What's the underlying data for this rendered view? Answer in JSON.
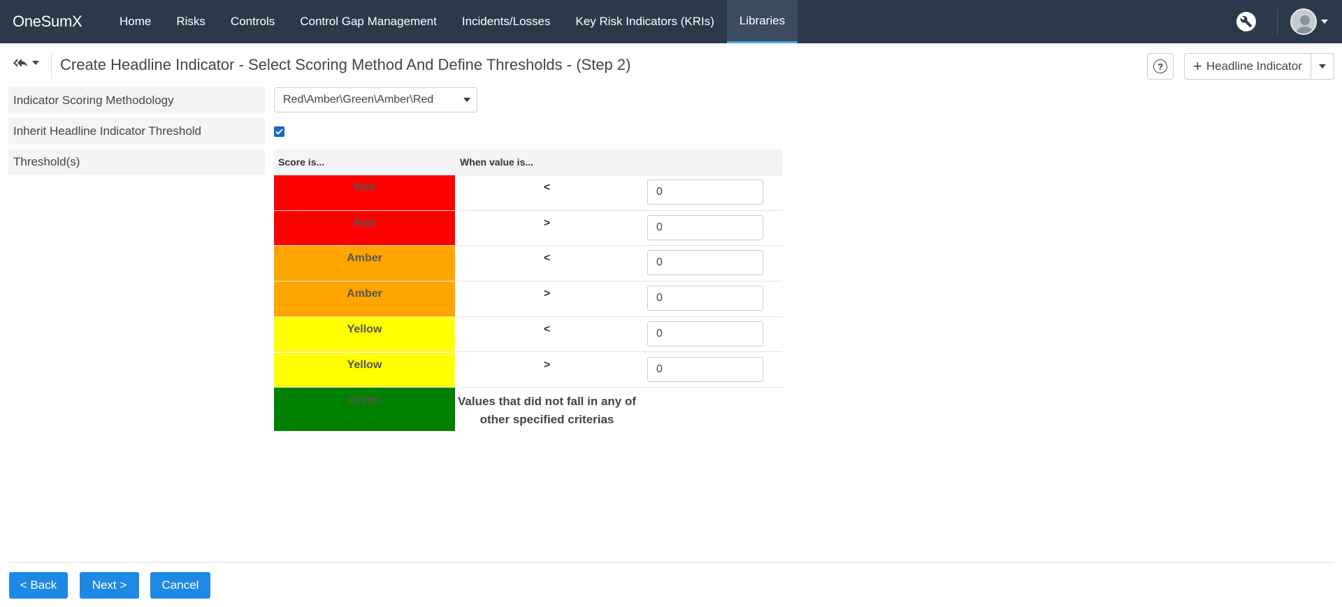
{
  "brand": "OneSumX",
  "nav": [
    "Home",
    "Risks",
    "Controls",
    "Control Gap Management",
    "Incidents/Losses",
    "Key Risk Indicators (KRIs)",
    "Libraries"
  ],
  "nav_active": "Libraries",
  "page": {
    "title": "Create Headline Indicator - Select Scoring Method And Define Thresholds - (Step 2)",
    "add_button": "Headline Indicator"
  },
  "form": {
    "scoring_label": "Indicator Scoring Methodology",
    "scoring_value": "Red\\Amber\\Green\\Amber\\Red",
    "inherit_label": "Inherit Headline Indicator Threshold",
    "inherit_checked": true,
    "thresholds_label": "Threshold(s)"
  },
  "table": {
    "col_score": "Score is...",
    "col_when": "When value is...",
    "rows": [
      {
        "score": "Red",
        "color": "#ff0000",
        "op": "<",
        "value": "0"
      },
      {
        "score": "Red",
        "color": "#ff0000",
        "op": ">",
        "value": "0"
      },
      {
        "score": "Amber",
        "color": "#ffa500",
        "op": "<",
        "value": "0"
      },
      {
        "score": "Amber",
        "color": "#ffa500",
        "op": ">",
        "value": "0"
      },
      {
        "score": "Yellow",
        "color": "#ffff00",
        "op": "<",
        "value": "0"
      },
      {
        "score": "Yellow",
        "color": "#ffff00",
        "op": ">",
        "value": "0"
      }
    ],
    "green": {
      "score": "Green",
      "color": "#008000",
      "text": "Values that did not fall in any of other specified criterias"
    }
  },
  "footer": {
    "back": "< Back",
    "next": "Next >",
    "cancel": "Cancel"
  }
}
